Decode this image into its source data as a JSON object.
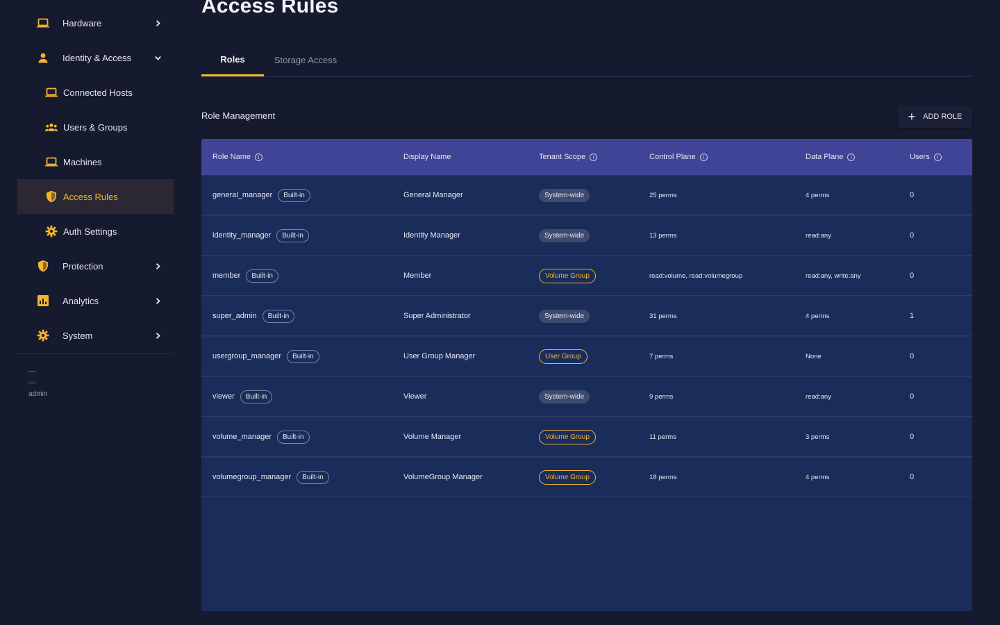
{
  "page": {
    "title": "Access Rules"
  },
  "colors": {
    "accent": "#f3b42e",
    "background": "#161a2e",
    "table_header": "#3f4496",
    "table_body": "#1a2d5a"
  },
  "sidebar": {
    "items": [
      {
        "label": "Hardware",
        "icon": "laptop-icon",
        "level": "top",
        "chevron": "right"
      },
      {
        "label": "Identity & Access",
        "icon": "person-icon",
        "level": "top",
        "chevron": "down"
      },
      {
        "label": "Connected Hosts",
        "icon": "laptop-icon",
        "level": "sub"
      },
      {
        "label": "Users & Groups",
        "icon": "group-icon",
        "level": "sub"
      },
      {
        "label": "Machines",
        "icon": "laptop-icon",
        "level": "sub"
      },
      {
        "label": "Access Rules",
        "icon": "shield-icon",
        "level": "sub",
        "active": true
      },
      {
        "label": "Auth Settings",
        "icon": "gear-icon",
        "level": "sub"
      },
      {
        "label": "Protection",
        "icon": "shield-icon",
        "level": "top",
        "chevron": "right"
      },
      {
        "label": "Analytics",
        "icon": "chart-icon",
        "level": "top",
        "chevron": "right"
      },
      {
        "label": "System",
        "icon": "gear-icon",
        "level": "top",
        "chevron": "right"
      }
    ],
    "user": {
      "line1": "—",
      "line2": "—",
      "role": "admin"
    }
  },
  "tabs": [
    {
      "label": "Roles",
      "active": true
    },
    {
      "label": "Storage Access",
      "active": false
    }
  ],
  "section": {
    "title": "Role Management",
    "add_button": "ADD ROLE"
  },
  "table": {
    "columns": [
      {
        "label": "Role Name",
        "info": true
      },
      {
        "label": "Display Name",
        "info": false
      },
      {
        "label": "Tenant Scope",
        "info": true
      },
      {
        "label": "Control Plane",
        "info": true
      },
      {
        "label": "Data Plane",
        "info": true
      },
      {
        "label": "Users",
        "info": true
      }
    ],
    "badge_label": "Built-in",
    "rows": [
      {
        "role": "general_manager",
        "display": "General Manager",
        "scope": "System-wide",
        "scope_type": "system",
        "control": "25 perms",
        "data": "4 perms",
        "users": "0"
      },
      {
        "role": "identity_manager",
        "display": "Identity Manager",
        "scope": "System-wide",
        "scope_type": "system",
        "control": "13 perms",
        "data": "read:any",
        "users": "0"
      },
      {
        "role": "member",
        "display": "Member",
        "scope": "Volume Group",
        "scope_type": "group",
        "control": "read:volume, read:volumegroup",
        "data": "read:any, write:any",
        "users": "0"
      },
      {
        "role": "super_admin",
        "display": "Super Administrator",
        "scope": "System-wide",
        "scope_type": "system",
        "control": "31 perms",
        "data": "4 perms",
        "users": "1"
      },
      {
        "role": "usergroup_manager",
        "display": "User Group Manager",
        "scope": "User Group",
        "scope_type": "group",
        "control": "7 perms",
        "data": "None",
        "users": "0"
      },
      {
        "role": "viewer",
        "display": "Viewer",
        "scope": "System-wide",
        "scope_type": "system",
        "control": "9 perms",
        "data": "read:any",
        "users": "0"
      },
      {
        "role": "volume_manager",
        "display": "Volume Manager",
        "scope": "Volume Group",
        "scope_type": "group",
        "control": "11 perms",
        "data": "3 perms",
        "users": "0"
      },
      {
        "role": "volumegroup_manager",
        "display": "VolumeGroup Manager",
        "scope": "Volume Group",
        "scope_type": "group",
        "control": "18 perms",
        "data": "4 perms",
        "users": "0"
      }
    ]
  }
}
